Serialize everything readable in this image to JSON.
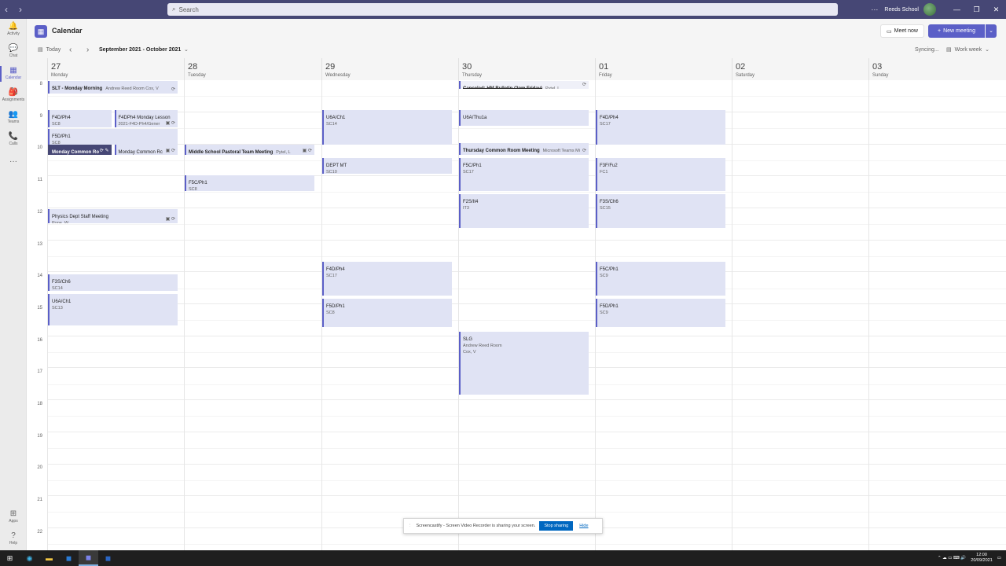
{
  "titlebar": {
    "search_placeholder": "Search",
    "org_name": "Reeds School",
    "more": "···",
    "back": "‹",
    "forward": "›",
    "min": "—",
    "restore": "❐",
    "close": "✕"
  },
  "rail": [
    {
      "label": "Activity",
      "icon": "🔔"
    },
    {
      "label": "Chat",
      "icon": "💬"
    },
    {
      "label": "Calendar",
      "icon": "▦"
    },
    {
      "label": "Assignments",
      "icon": "🎒"
    },
    {
      "label": "Teams",
      "icon": "👥"
    },
    {
      "label": "Calls",
      "icon": "📞"
    },
    {
      "label": "",
      "icon": "···"
    },
    {
      "label": "Apps",
      "icon": "⊞"
    },
    {
      "label": "Help",
      "icon": "?"
    }
  ],
  "header": {
    "title": "Calendar",
    "meet_now": "Meet now",
    "new_meeting": "New meeting"
  },
  "toolbar": {
    "today": "Today",
    "range": "September 2021 - October 2021",
    "syncing": "Syncing...",
    "view": "Work week"
  },
  "days": [
    {
      "num": "27",
      "name": "Monday"
    },
    {
      "num": "28",
      "name": "Tuesday"
    },
    {
      "num": "29",
      "name": "Wednesday"
    },
    {
      "num": "30",
      "name": "Thursday"
    },
    {
      "num": "01",
      "name": "Friday"
    },
    {
      "num": "02",
      "name": "Saturday"
    },
    {
      "num": "03",
      "name": "Sunday"
    }
  ],
  "hours": [
    "8",
    "9",
    "10",
    "11",
    "12",
    "13",
    "14",
    "15",
    "16",
    "17",
    "18",
    "19",
    "20",
    "21",
    "22"
  ],
  "events": [
    {
      "day": 0,
      "col": 0,
      "cols": 1,
      "start": 8.0,
      "end": 8.4,
      "title": "SLT - Monday Morning",
      "sub": "Andrew Reed Room  Cox, V",
      "inline": true,
      "icons": "⟳"
    },
    {
      "day": 0,
      "col": 0,
      "cols": 2,
      "start": 8.9,
      "end": 9.45,
      "title": "F4D/Ph4",
      "sub": "SC8"
    },
    {
      "day": 0,
      "col": 1,
      "cols": 2,
      "start": 8.9,
      "end": 9.45,
      "title": "F4DPh4 Monday Lesson",
      "sub": "2021-F4D-Ph4/Gener",
      "icons": "▣ ⟳"
    },
    {
      "day": 0,
      "col": 0,
      "cols": 1,
      "start": 9.5,
      "end": 10.0,
      "title": "F5D/Ph1",
      "sub": "SC8"
    },
    {
      "day": 0,
      "col": 0,
      "cols": 2,
      "start": 10.0,
      "end": 10.3,
      "title": "Monday Common Ro",
      "sub": "",
      "dark": true,
      "icons": "⟳ ✎"
    },
    {
      "day": 0,
      "col": 1,
      "cols": 2,
      "start": 10.0,
      "end": 10.3,
      "title": "Monday Common Rc",
      "sub": "",
      "icons": "▣ ⟳"
    },
    {
      "day": 0,
      "col": 0,
      "cols": 1,
      "start": 12.0,
      "end": 12.45,
      "title": "Physics Dept Staff Meeting",
      "sub": "Pope, W",
      "icons": "▣ ⟳"
    },
    {
      "day": 0,
      "col": 0,
      "cols": 1,
      "start": 14.05,
      "end": 14.55,
      "title": "F3S/Ch6",
      "sub": "SC14"
    },
    {
      "day": 0,
      "col": 0,
      "cols": 1,
      "start": 14.65,
      "end": 15.65,
      "title": "U6A/Ch1",
      "sub": "SC13"
    },
    {
      "day": 1,
      "col": 0,
      "cols": 1,
      "start": 10.0,
      "end": 10.3,
      "title": "Middle School Pastoral Team Meeting",
      "sub": "Pytel, L",
      "inline": true,
      "icons": "▣ ⟳"
    },
    {
      "day": 1,
      "col": 0,
      "cols": 1,
      "start": 10.95,
      "end": 11.45,
      "title": "F5C/Ph1",
      "sub": "SC8"
    },
    {
      "day": 2,
      "col": 0,
      "cols": 1,
      "start": 8.9,
      "end": 10.0,
      "title": "U6A/Ch1",
      "sub": "SC14"
    },
    {
      "day": 2,
      "col": 0,
      "cols": 1,
      "start": 10.4,
      "end": 10.9,
      "title": "DEPT MT",
      "sub": "SC10"
    },
    {
      "day": 2,
      "col": 0,
      "cols": 1,
      "start": 13.65,
      "end": 14.7,
      "title": "F4D/Ph4",
      "sub": "SC17"
    },
    {
      "day": 2,
      "col": 0,
      "cols": 1,
      "start": 14.8,
      "end": 15.7,
      "title": "F5D/Ph1",
      "sub": "SC8"
    },
    {
      "day": 3,
      "col": 0,
      "cols": 1,
      "start": 8.0,
      "end": 8.25,
      "title": "Canceled: HM Bulletin (2pm Friday)",
      "sub": "Pytel, L",
      "inline": true,
      "cancel": true,
      "icons": "⟳"
    },
    {
      "day": 3,
      "col": 0,
      "cols": 1,
      "start": 8.9,
      "end": 9.4,
      "title": "U6A/Thu1a",
      "sub": ""
    },
    {
      "day": 3,
      "col": 0,
      "cols": 1,
      "start": 9.95,
      "end": 10.3,
      "title": "Thursday Common Room Meeting",
      "sub": "Microsoft Teams Mi",
      "inline": true,
      "icons": "⟳"
    },
    {
      "day": 3,
      "col": 0,
      "cols": 1,
      "start": 10.4,
      "end": 11.45,
      "title": "F5C/Ph1",
      "sub": "SC17"
    },
    {
      "day": 3,
      "col": 0,
      "cols": 1,
      "start": 11.55,
      "end": 12.6,
      "title": "F2S/It4",
      "sub": "IT3"
    },
    {
      "day": 3,
      "col": 0,
      "cols": 1,
      "start": 15.85,
      "end": 17.8,
      "title": "SLG",
      "sub": "Andrew Reed Room",
      "sub2": "Cox, V"
    },
    {
      "day": 4,
      "col": 0,
      "cols": 1,
      "start": 8.9,
      "end": 10.0,
      "title": "F4D/Ph4",
      "sub": "SC17"
    },
    {
      "day": 4,
      "col": 0,
      "cols": 1,
      "start": 10.4,
      "end": 11.45,
      "title": "F3F/Fu2",
      "sub": "FC1"
    },
    {
      "day": 4,
      "col": 0,
      "cols": 1,
      "start": 11.55,
      "end": 12.6,
      "title": "F3S/Ch6",
      "sub": "SC15"
    },
    {
      "day": 4,
      "col": 0,
      "cols": 1,
      "start": 13.65,
      "end": 14.7,
      "title": "F5C/Ph1",
      "sub": "SC9"
    },
    {
      "day": 4,
      "col": 0,
      "cols": 1,
      "start": 14.8,
      "end": 15.7,
      "title": "F5D/Ph1",
      "sub": "SC9"
    }
  ],
  "toast": {
    "message": "Screencastify - Screen Video Recorder is sharing your screen.",
    "stop": "Stop sharing",
    "hide": "Hide"
  },
  "taskbar": {
    "time": "12:00",
    "date": "20/09/2021",
    "tray": "⌃  ☁  ▭  ⌨  🔊"
  }
}
